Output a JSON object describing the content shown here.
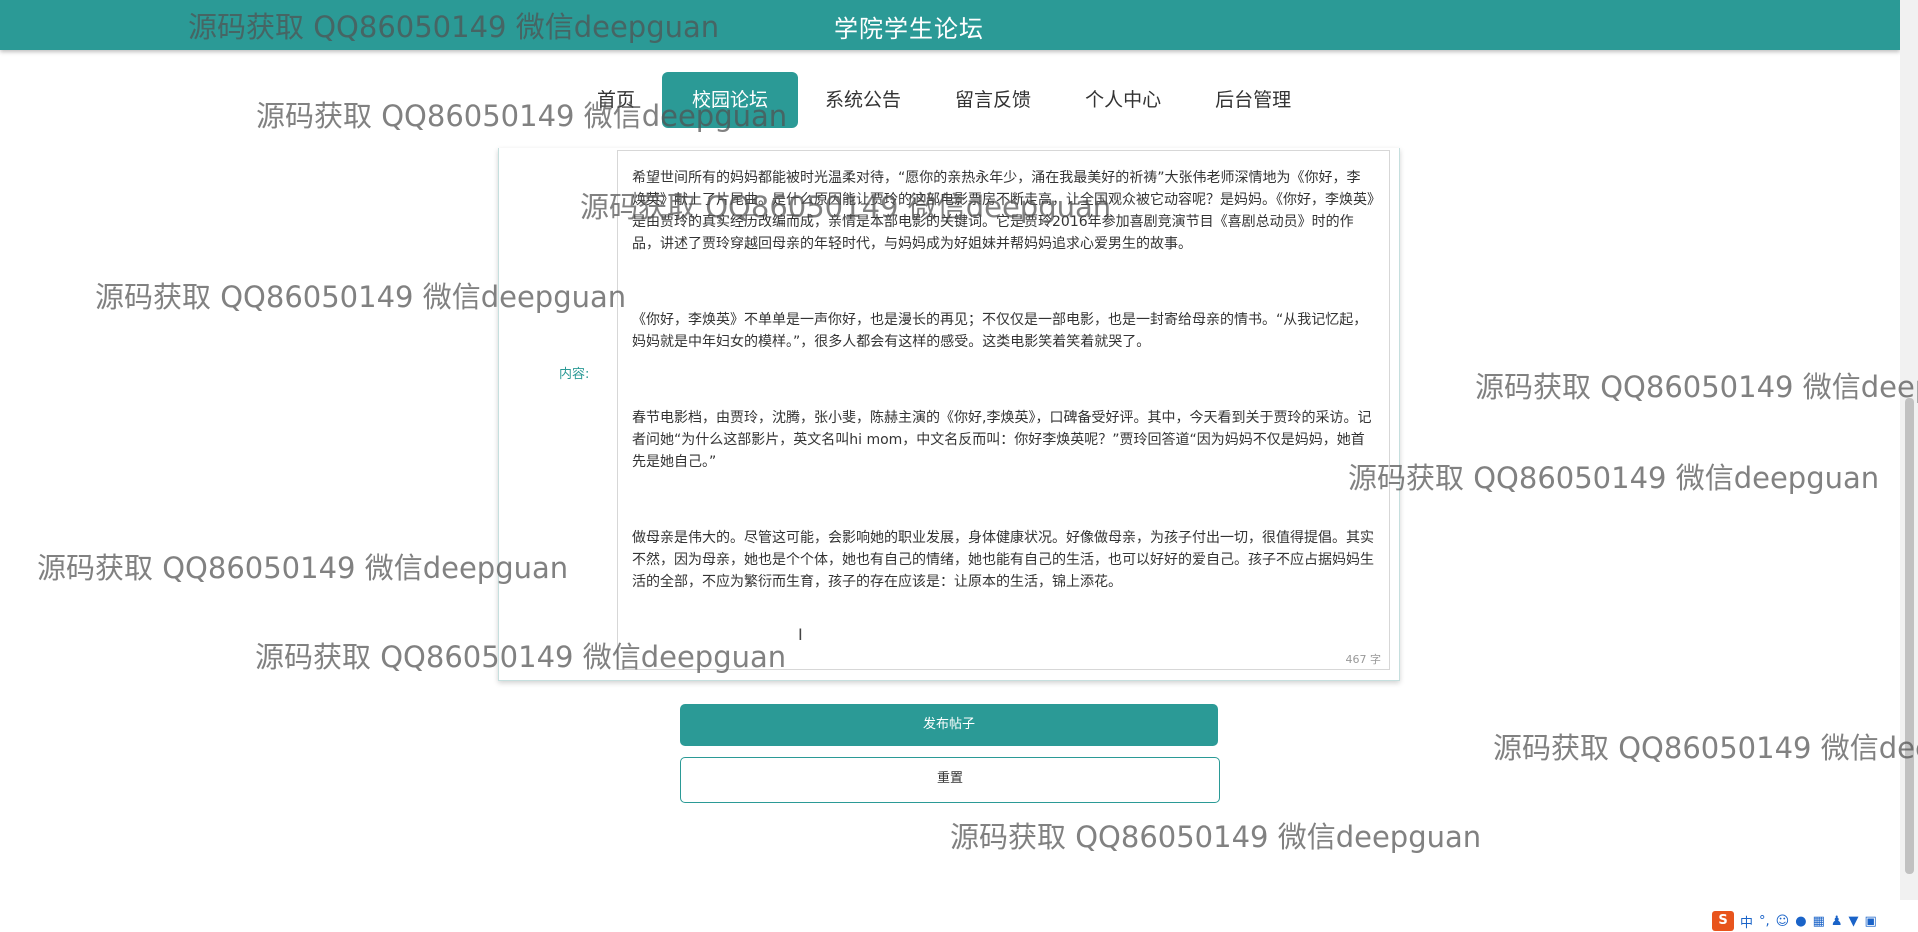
{
  "header": {
    "site_title": "学院学生论坛"
  },
  "nav": {
    "items": [
      {
        "label": "首页"
      },
      {
        "label": "校园论坛"
      },
      {
        "label": "系统公告"
      },
      {
        "label": "留言反馈"
      },
      {
        "label": "个人中心"
      },
      {
        "label": "后台管理"
      }
    ],
    "active_index": 1
  },
  "form": {
    "content_label": "内容:",
    "content_paragraphs": [
      "希望世间所有的妈妈都能被时光温柔对待，“愿你的亲热永年少，涌在我最美好的祈祷”大张伟老师深情地为《你好，李焕英》献上了片尾曲。是什么原因能让贾玲的这部电影票房不断走高，让全国观众被它动容呢？是妈妈。《你好，李焕英》是由贾玲的真实经历改编而成，亲情是本部电影的关键词。它是贾玲2016年参加喜剧竞演节目《喜剧总动员》时的作品，讲述了贾玲穿越回母亲的年轻时代，与妈妈成为好姐妹并帮妈妈追求心爱男生的故事。",
      "《你好，李焕英》不单单是一声你好，也是漫长的再见；不仅仅是一部电影，也是一封寄给母亲的情书。“从我记忆起，妈妈就是中年妇女的模样。”，很多人都会有这样的感受。这类电影笑着笑着就哭了。",
      "春节电影档，由贾玲，沈腾，张小斐，陈赫主演的《你好,李焕英》，口碑备受好评。其中，今天看到关于贾玲的采访。记者问她“为什么这部影片，英文名叫hi mom，中文名反而叫：你好李焕英呢？”贾玲回答道“因为妈妈不仅是妈妈，她首先是她自己。”",
      "做母亲是伟大的。尽管这可能，会影响她的职业发展，身体健康状况。好像做母亲，为孩子付出一切，很值得提倡。其实不然，因为母亲，她也是个个体，她也有自己的情绪，她也能有自己的生活，也可以好好的爱自己。孩子不应占据妈妈生活的全部，不应为繁衍而生育，孩子的存在应该是：让原本的生活，锦上添花。"
    ],
    "char_count": "467 字",
    "submit_label": "发布帖子",
    "reset_label": "重置"
  },
  "watermark_text": "源码获取 QQ86050149 微信deepguan",
  "ime": {
    "logo": "S",
    "lang": "中",
    "punct": "°,"
  },
  "colors": {
    "accent": "#2b9a96"
  }
}
